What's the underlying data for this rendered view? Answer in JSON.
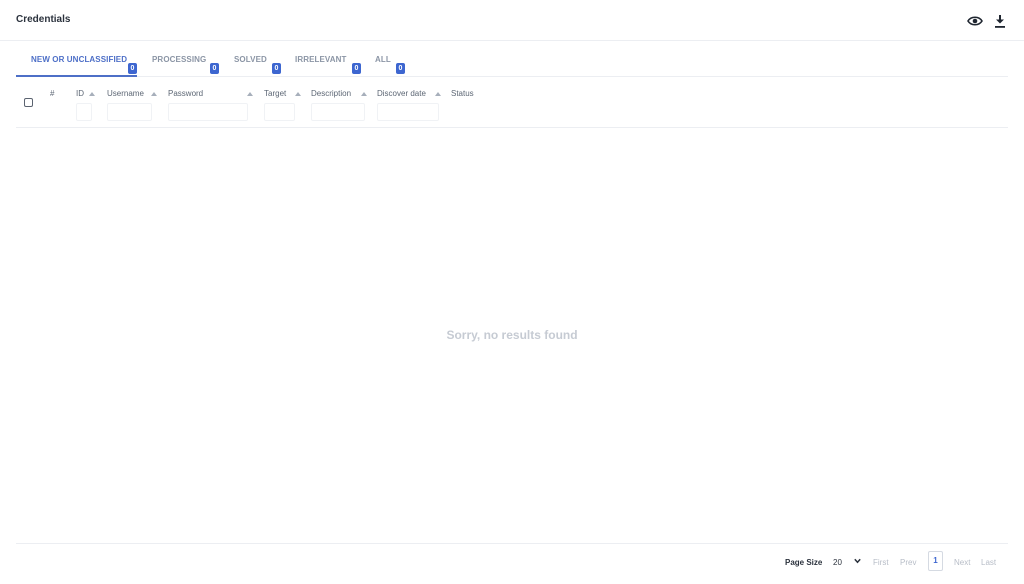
{
  "header": {
    "title": "Credentials",
    "icons": {
      "view": "eye-icon",
      "download": "download-icon"
    }
  },
  "tabs": [
    {
      "label": "NEW OR UNCLASSIFIED",
      "count": "0",
      "active": true
    },
    {
      "label": "PROCESSING",
      "count": "0",
      "active": false
    },
    {
      "label": "SOLVED",
      "count": "0",
      "active": false
    },
    {
      "label": "IRRELEVANT",
      "count": "0",
      "active": false
    },
    {
      "label": "ALL",
      "count": "0",
      "active": false
    }
  ],
  "table": {
    "columns": {
      "index": "#",
      "id": "ID",
      "username": "Username",
      "password": "Password",
      "target": "Target",
      "description": "Description",
      "discover_date": "Discover date",
      "status": "Status"
    },
    "empty_message": "Sorry, no results found"
  },
  "pagination": {
    "page_size_label": "Page Size",
    "page_size": "20",
    "first": "First",
    "prev": "Prev",
    "current_page": "1",
    "next": "Next",
    "last": "Last"
  },
  "colors": {
    "accent": "#4d6fc7",
    "badge": "#3d66d0",
    "muted_text": "#8b95a5",
    "divider": "#eceef2"
  }
}
